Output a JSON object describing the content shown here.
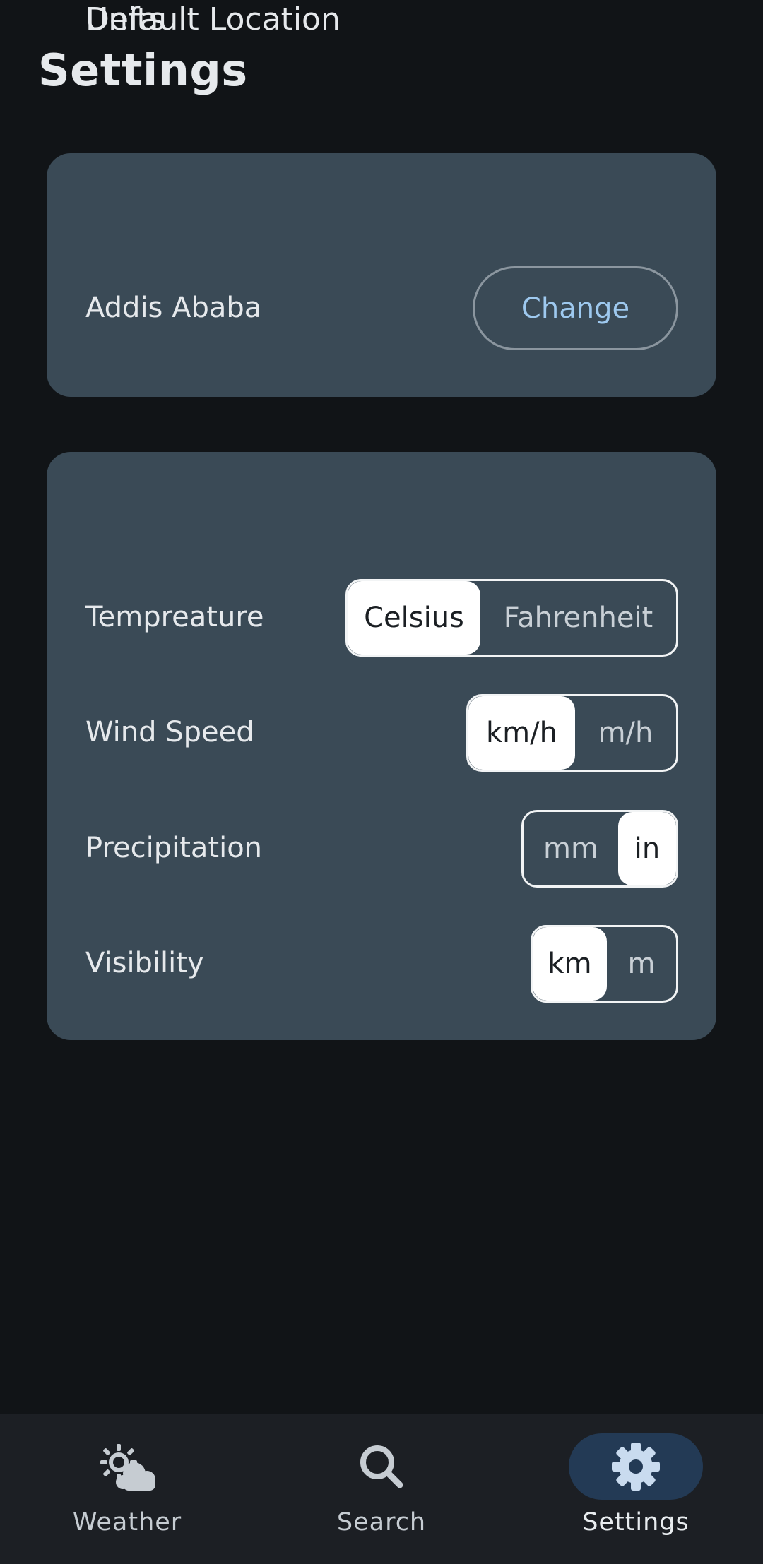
{
  "header": {
    "title": "Settings"
  },
  "location_card": {
    "title": "Default Location",
    "location": "Addis Ababa",
    "change_label": "Change"
  },
  "units_card": {
    "title": "Units",
    "temperature": {
      "label": "Tempreature",
      "options": [
        "Celsius",
        "Fahrenheit"
      ],
      "selected": "Celsius"
    },
    "wind_speed": {
      "label": "Wind Speed",
      "options": [
        "km/h",
        "m/h"
      ],
      "selected": "km/h"
    },
    "precipitation": {
      "label": "Precipitation",
      "options": [
        "mm",
        "in"
      ],
      "selected": "in"
    },
    "visibility": {
      "label": "Visibility",
      "options": [
        "km",
        "m"
      ],
      "selected": "km"
    }
  },
  "bottom_nav": {
    "items": [
      {
        "label": "Weather",
        "icon": "partly-cloudy-icon",
        "active": false
      },
      {
        "label": "Search",
        "icon": "search-icon",
        "active": false
      },
      {
        "label": "Settings",
        "icon": "gear-icon",
        "active": true
      }
    ]
  },
  "colors": {
    "background": "#111417",
    "card": "#3a4a56",
    "accent_text": "#9ec9ef",
    "nav_active": "#233a55"
  }
}
